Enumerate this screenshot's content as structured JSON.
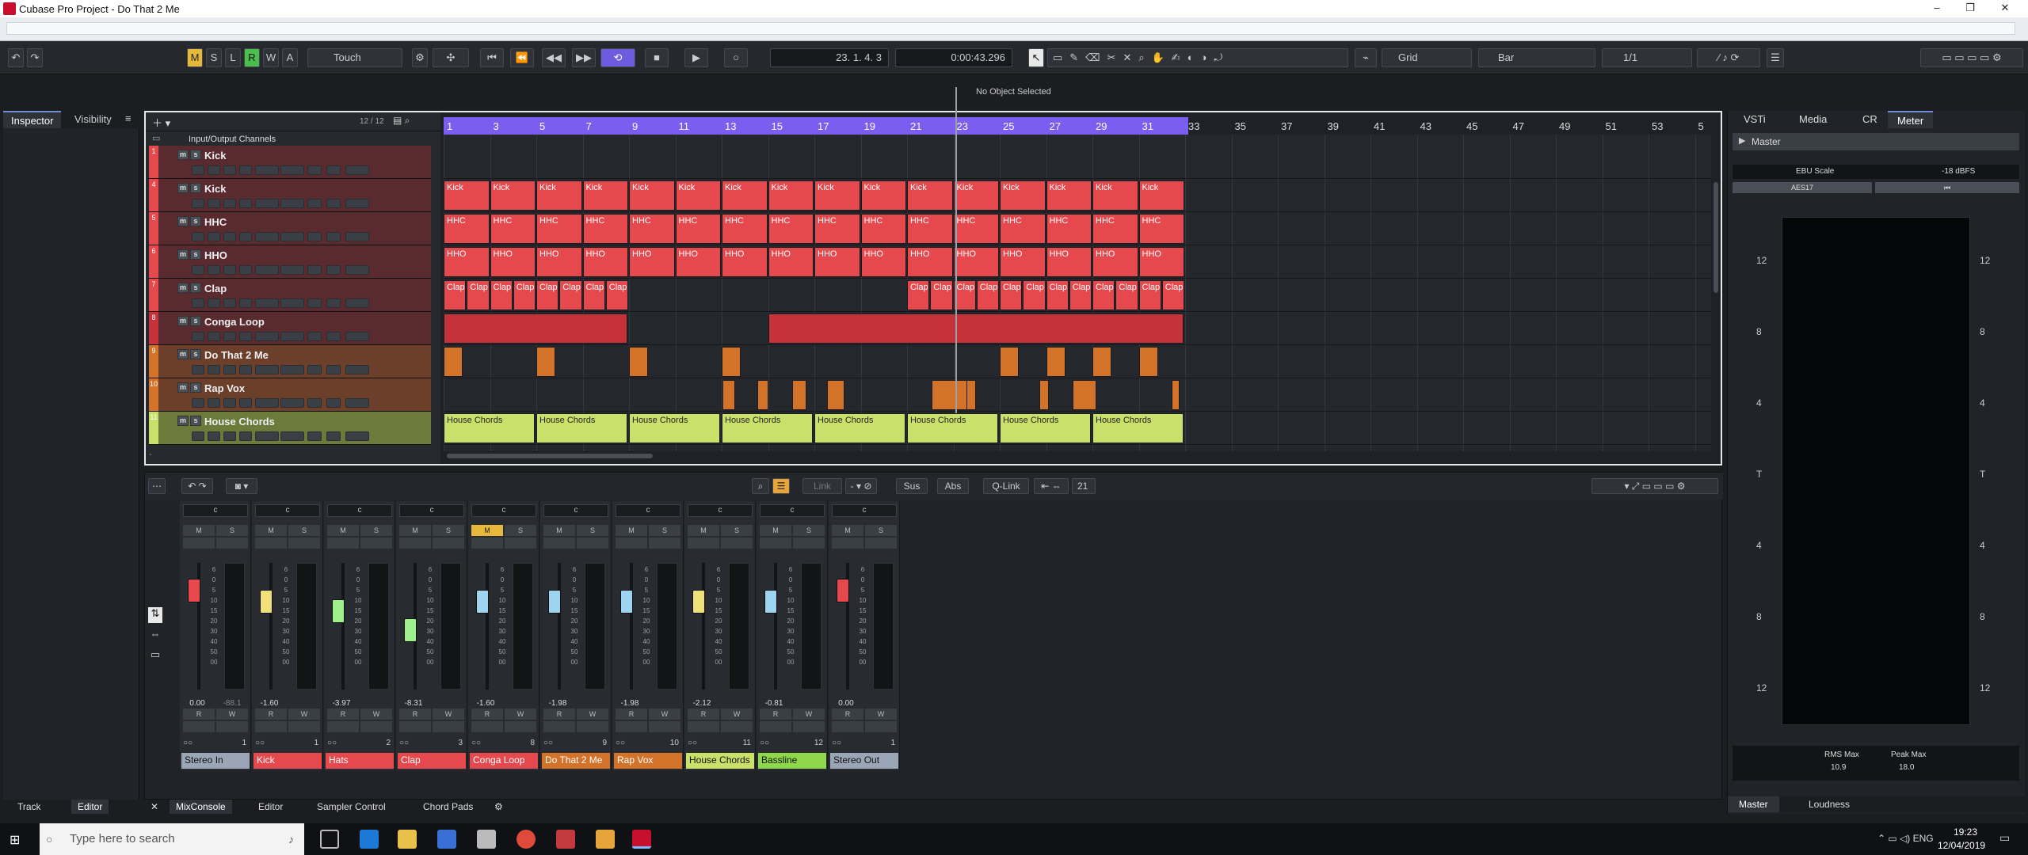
{
  "window": {
    "title": "Cubase Pro Project - Do That 2 Me"
  },
  "toolbar": {
    "m": "M",
    "s": "S",
    "l": "L",
    "r": "R",
    "w": "W",
    "a": "A",
    "automation_mode": "Touch",
    "position": "23. 1. 4.  3",
    "time": "0:00:43.296",
    "snap_type": "Grid",
    "grid": "Bar",
    "quantize": "1/1",
    "status": "No Object Selected"
  },
  "left_tabs": {
    "inspector": "Inspector",
    "visibility": "Visibility"
  },
  "project": {
    "track_count": "12 / 12",
    "folder": "Input/Output Channels",
    "tracks": [
      {
        "num": "1",
        "name": "Kick",
        "color": "#e5484d"
      },
      {
        "num": "4",
        "name": "Kick",
        "color": "#e5484d"
      },
      {
        "num": "5",
        "name": "HHC",
        "color": "#e5484d"
      },
      {
        "num": "6",
        "name": "HHO",
        "color": "#e5484d"
      },
      {
        "num": "7",
        "name": "Clap",
        "color": "#e5484d"
      },
      {
        "num": "8",
        "name": "Conga Loop",
        "color": "#c6323a"
      },
      {
        "num": "9",
        "name": "Do That 2 Me",
        "color": "#d3732a"
      },
      {
        "num": "10",
        "name": "Rap Vox",
        "color": "#d3732a"
      },
      {
        "num": "11",
        "name": "House Chords",
        "color": "#cbe06a"
      }
    ],
    "bars": [
      "1",
      "3",
      "5",
      "7",
      "9",
      "11",
      "13",
      "15",
      "17",
      "19",
      "21",
      "23",
      "25",
      "27",
      "29",
      "31",
      "33",
      "35",
      "37",
      "39",
      "41",
      "43",
      "45",
      "47",
      "49",
      "51",
      "53",
      "5"
    ],
    "event_labels": {
      "kick": "Kick",
      "hhc": "HHC",
      "hho": "HHO",
      "clap": "Clap",
      "chords": "House Chords"
    }
  },
  "mixconsole": {
    "link": "Link",
    "sus": "Sus",
    "abs": "Abs",
    "qlink": "Q-Link",
    "count": "21",
    "channels": [
      {
        "name": "Stereo In",
        "val": "0.00",
        "peak": "-88.1",
        "route": "1",
        "color": "#9aa6b6",
        "fader": "#e5484d"
      },
      {
        "name": "Kick",
        "val": "-1.60",
        "peak": "",
        "route": "1",
        "color": "#e5484d",
        "fader": "#f0e07a"
      },
      {
        "name": "Hats",
        "val": "-3.97",
        "peak": "",
        "route": "2",
        "color": "#e5484d",
        "fader": "#9ef08a"
      },
      {
        "name": "Clap",
        "val": "-8.31",
        "peak": "",
        "route": "3",
        "color": "#e5484d",
        "fader": "#9ef08a"
      },
      {
        "name": "Conga Loop",
        "val": "-1.60",
        "peak": "",
        "route": "8",
        "color": "#e5484d",
        "fader": "#9fd4f0"
      },
      {
        "name": "Do That 2 Me",
        "val": "-1.98",
        "peak": "",
        "route": "9",
        "color": "#d3732a",
        "fader": "#9fd4f0"
      },
      {
        "name": "Rap Vox",
        "val": "-1.98",
        "peak": "",
        "route": "10",
        "color": "#d3732a",
        "fader": "#9fd4f0"
      },
      {
        "name": "House Chords",
        "val": "-2.12",
        "peak": "",
        "route": "11",
        "color": "#cbe06a",
        "fader": "#f0e07a"
      },
      {
        "name": "Bassline",
        "val": "-0.81",
        "peak": "",
        "route": "12",
        "color": "#8fd84a",
        "fader": "#9fd4f0"
      },
      {
        "name": "Stereo Out",
        "val": "0.00",
        "peak": "",
        "route": "1",
        "color": "#9aa6b6",
        "fader": "#e5484d"
      }
    ],
    "scale": [
      "6",
      "0",
      "5",
      "10",
      "15",
      "20",
      "30",
      "40",
      "50",
      "00"
    ]
  },
  "lower_tabs": {
    "track": "Track",
    "editor": "Editor",
    "mixconsole": "MixConsole",
    "editor2": "Editor",
    "sampler": "Sampler Control",
    "chord": "Chord Pads"
  },
  "right_zone": {
    "tabs": [
      "VSTi",
      "Media",
      "CR",
      "Meter"
    ],
    "master": "Master",
    "ebu": "EBU Scale",
    "dbfs": "-18 dBFS",
    "aes": "AES17",
    "scale_left": [
      "12",
      "8",
      "4",
      "T",
      "4",
      "8",
      "12"
    ],
    "scale_right": [
      "12",
      "8",
      "4",
      "T",
      "4",
      "8",
      "12"
    ],
    "rms_label": "RMS Max",
    "rms_val": "10.9",
    "peak_label": "Peak Max",
    "peak_val": "18.0",
    "bottom_tabs": [
      "Master",
      "Loudness"
    ]
  },
  "taskbar": {
    "search": "Type here to search",
    "time": "19:23",
    "date": "12/04/2019"
  }
}
